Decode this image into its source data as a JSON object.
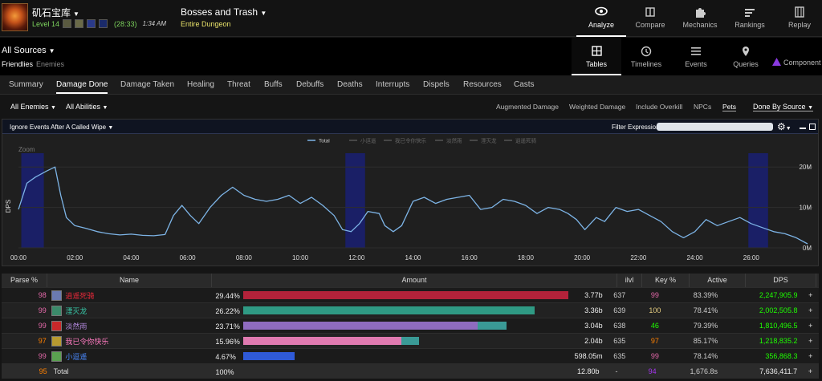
{
  "character": {
    "name": "矶石宝库",
    "level": "Level 14",
    "key_time": "(28:33)",
    "clock": "1:34 AM"
  },
  "fight": {
    "name": "Bosses and Trash",
    "sub": "Entire Dungeon"
  },
  "top_nav": [
    {
      "label": "Analyze",
      "icon": "eye-icon"
    },
    {
      "label": "Compare",
      "icon": "compare-icon"
    },
    {
      "label": "Mechanics",
      "icon": "puzzle-icon"
    },
    {
      "label": "Rankings",
      "icon": "rankings-icon"
    },
    {
      "label": "Replay",
      "icon": "replay-icon"
    }
  ],
  "sources": {
    "label": "All Sources",
    "friendlies": "Friendlies",
    "enemies": "Enemies"
  },
  "view_nav": [
    {
      "label": "Tables",
      "icon": "grid-icon"
    },
    {
      "label": "Timelines",
      "icon": "clock-icon"
    },
    {
      "label": "Events",
      "icon": "list-icon"
    },
    {
      "label": "Queries",
      "icon": "pin-icon"
    },
    {
      "label": "Component",
      "icon": "triangle-icon"
    }
  ],
  "tabs": [
    "Summary",
    "Damage Done",
    "Damage Taken",
    "Healing",
    "Threat",
    "Buffs",
    "Debuffs",
    "Deaths",
    "Interrupts",
    "Dispels",
    "Resources",
    "Casts"
  ],
  "filters": {
    "enemies": "All Enemies",
    "abilities": "All Abilities",
    "options": [
      "Augmented Damage",
      "Weighted Damage",
      "Include Overkill",
      "NPCs",
      "Pets"
    ],
    "done_by": "Done By Source"
  },
  "chart_panel": {
    "ignore_label": "Ignore Events After A Called Wipe",
    "filter_label": "Filter Expression:",
    "filter_value": "",
    "zoom_label": "Zoom"
  },
  "chart_data": {
    "type": "line",
    "ylabel": "DPS",
    "legend": [
      "Total",
      "小逗遥",
      "我已令你快乐",
      "淡然雨",
      "湮灭龙",
      "逍遥死骑"
    ],
    "legend_placement": "top-center",
    "x_ticks": [
      "00:00",
      "02:00",
      "04:00",
      "06:00",
      "08:00",
      "10:00",
      "12:00",
      "14:00",
      "16:00",
      "18:00",
      "20:00",
      "22:00",
      "24:00",
      "26:00"
    ],
    "y_ticks": [
      "0M",
      "10M",
      "20M"
    ],
    "ylim": [
      0,
      25
    ],
    "xlim_minutes": [
      0,
      28.2
    ],
    "boss_regions_minutes": [
      [
        0.1,
        0.9
      ],
      [
        11.6,
        12.3
      ],
      [
        25.9,
        26.6
      ]
    ],
    "series": [
      {
        "name": "Total",
        "x_minutes": [
          0,
          0.3,
          0.6,
          1.0,
          1.3,
          1.5,
          1.7,
          2.0,
          2.4,
          2.8,
          3.2,
          3.6,
          4.0,
          4.4,
          4.8,
          5.2,
          5.5,
          5.8,
          6.1,
          6.4,
          6.8,
          7.2,
          7.6,
          8.0,
          8.4,
          8.8,
          9.2,
          9.6,
          10.0,
          10.4,
          10.8,
          11.2,
          11.5,
          11.8,
          12.1,
          12.4,
          12.8,
          13.0,
          13.3,
          13.6,
          14.0,
          14.4,
          14.8,
          15.2,
          15.6,
          16.0,
          16.4,
          16.8,
          17.2,
          17.6,
          18.0,
          18.4,
          18.8,
          19.2,
          19.5,
          19.8,
          20.1,
          20.5,
          20.8,
          21.2,
          21.6,
          22.0,
          22.4,
          22.8,
          23.2,
          23.6,
          24.0,
          24.4,
          24.8,
          25.2,
          25.6,
          26.0,
          26.4,
          26.8,
          27.2,
          27.6,
          28.0
        ],
        "y_millions": [
          9.5,
          16.0,
          17.5,
          19.0,
          20.0,
          13.0,
          7.5,
          5.5,
          4.8,
          4.0,
          3.5,
          3.2,
          3.4,
          3.1,
          3.0,
          3.3,
          8.0,
          10.5,
          8.0,
          6.0,
          10.0,
          13.0,
          15.0,
          13.0,
          12.0,
          11.5,
          12.0,
          13.0,
          11.0,
          12.5,
          10.5,
          8.0,
          4.5,
          4.0,
          6.0,
          9.0,
          8.5,
          5.5,
          4.0,
          5.5,
          11.5,
          12.5,
          11.0,
          12.0,
          12.5,
          13.0,
          9.5,
          10.0,
          12.0,
          11.5,
          10.5,
          8.5,
          10.0,
          9.5,
          8.5,
          7.0,
          4.5,
          7.5,
          6.5,
          10.0,
          9.0,
          9.5,
          8.0,
          6.5,
          4.0,
          2.5,
          4.0,
          7.0,
          5.5,
          6.5,
          7.5,
          6.0,
          5.0,
          4.0,
          3.5,
          2.5,
          1.0
        ]
      }
    ]
  },
  "table": {
    "headers": [
      "Parse %",
      "Name",
      "Amount",
      "ilvl",
      "Key %",
      "Active",
      "DPS",
      "+"
    ],
    "rows": [
      {
        "parse": "98",
        "parse_color": "#e268a8",
        "name": "逍遥死骑",
        "name_color": "#e8293a",
        "spec_color": "#6a7ab0",
        "pct": "29.44%",
        "amount": "3.77b",
        "ilvl": "637",
        "key": "99",
        "key_color": "#e268a8",
        "active": "83.39%",
        "dps": "2,247,905.9",
        "bar_color": "#b3223a",
        "main_frac": 1.0,
        "pet_frac": 0.0,
        "plus": "+"
      },
      {
        "parse": "99",
        "parse_color": "#e268a8",
        "name": "湮灭龙",
        "name_color": "#38c9a8",
        "spec_color": "#3b8a6a",
        "pct": "26.22%",
        "amount": "3.36b",
        "ilvl": "639",
        "key": "100",
        "key_color": "#e5cc80",
        "active": "78.41%",
        "dps": "2,002,505.8",
        "bar_color": "#2f9a84",
        "main_frac": 0.895,
        "pet_frac": 0.0,
        "plus": "+"
      },
      {
        "parse": "99",
        "parse_color": "#e268a8",
        "name": "淡然雨",
        "name_color": "#b58ae0",
        "spec_color": "#c8282a",
        "pct": "23.71%",
        "amount": "3.04b",
        "ilvl": "638",
        "key": "46",
        "key_color": "#1eff00",
        "active": "79.39%",
        "dps": "1,810,496.5",
        "bar_color": "#8f6cc0",
        "main_frac": 0.72,
        "pet_frac": 0.09,
        "plus": "+"
      },
      {
        "parse": "97",
        "parse_color": "#ff8000",
        "name": "我已令你快乐",
        "name_color": "#ff7ac0",
        "spec_color": "#b89a30",
        "pct": "15.96%",
        "amount": "2.04b",
        "ilvl": "635",
        "key": "97",
        "key_color": "#ff8000",
        "active": "85.17%",
        "dps": "1,218,835.2",
        "bar_color": "#e07ab0",
        "main_frac": 0.485,
        "pet_frac": 0.055,
        "plus": "+"
      },
      {
        "parse": "99",
        "parse_color": "#e268a8",
        "name": "小逗遥",
        "name_color": "#4a8aff",
        "spec_color": "#5aa050",
        "pct": "4.67%",
        "amount": "598.05m",
        "ilvl": "635",
        "key": "99",
        "key_color": "#e268a8",
        "active": "78.14%",
        "dps": "356,868.3",
        "bar_color": "#2f5ad8",
        "main_frac": 0.158,
        "pet_frac": 0.0,
        "plus": "+"
      }
    ],
    "total": {
      "parse": "95",
      "parse_color": "#ff8000",
      "name": "Total",
      "pct": "100%",
      "amount": "12.80b",
      "ilvl": "-",
      "key": "94",
      "key_color": "#a335ee",
      "active": "1,676.8s",
      "dps": "7,636,411.7",
      "plus": "+"
    }
  },
  "colors": {
    "dps_green": "#1eff00",
    "line": "#7db4e6",
    "boss_region": "#1a1f66"
  }
}
